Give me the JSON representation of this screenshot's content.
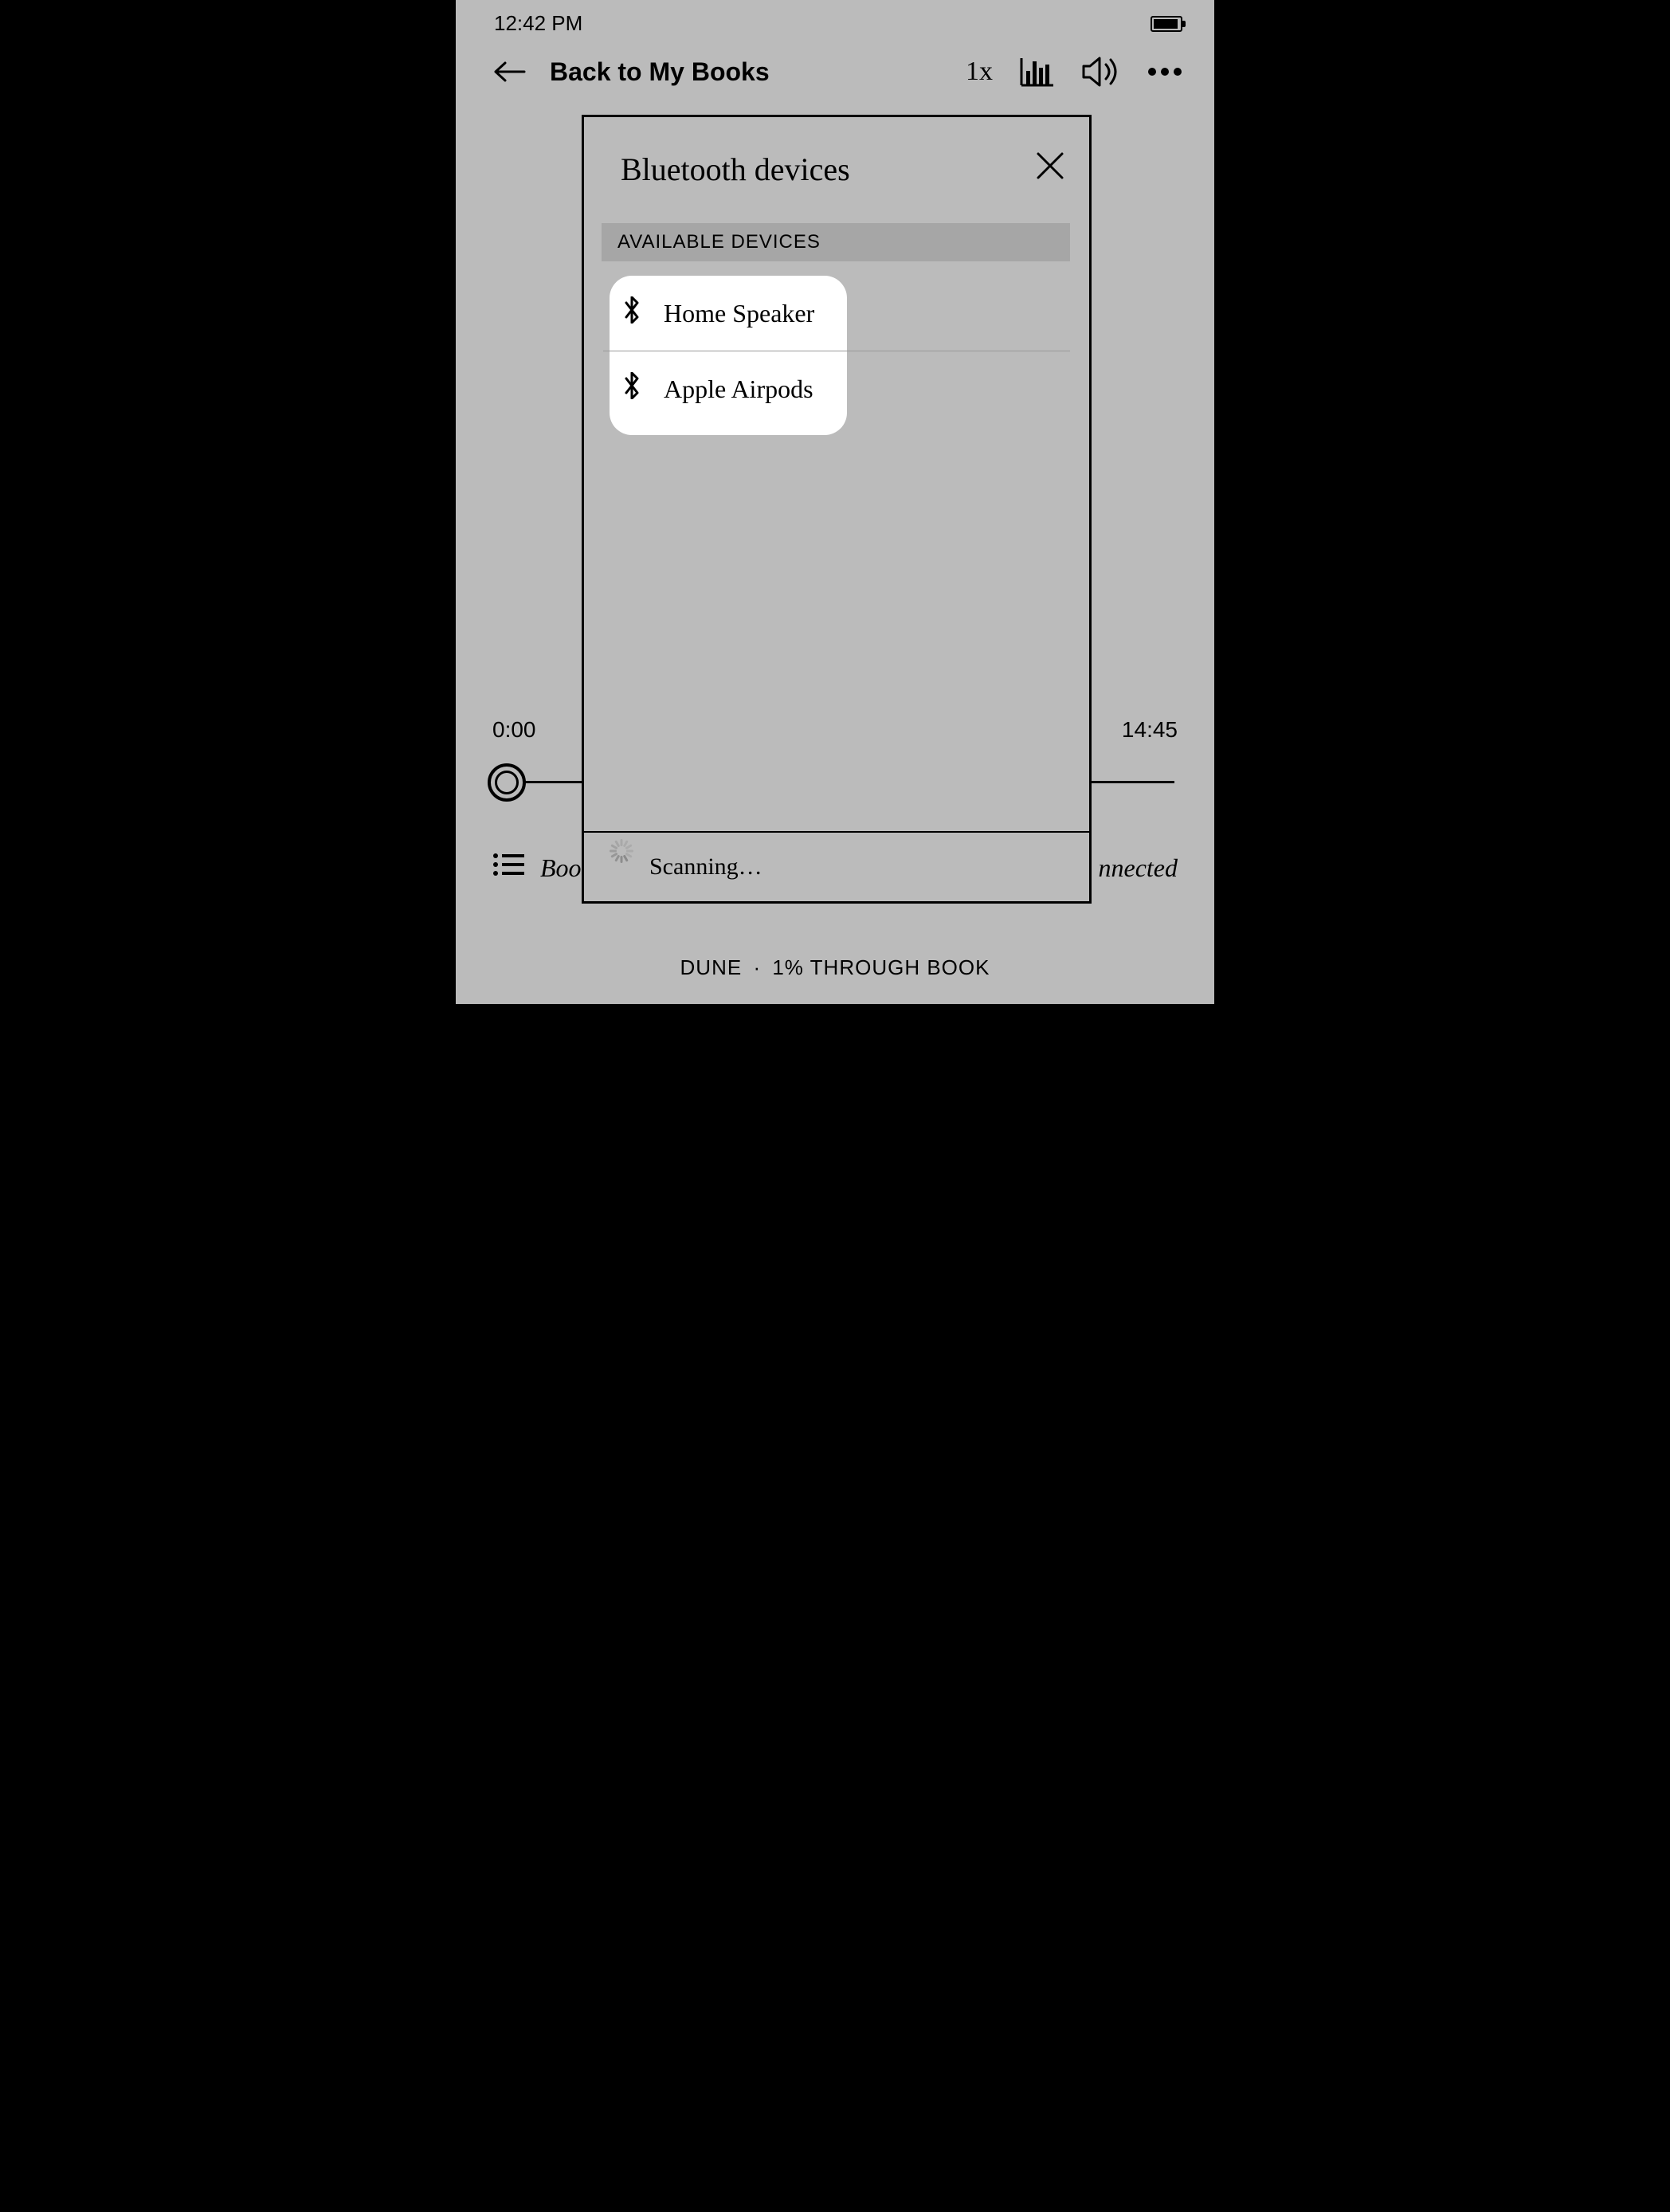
{
  "status": {
    "time": "12:42 PM"
  },
  "header": {
    "back_label": "Back to My Books",
    "speed": "1x"
  },
  "playback": {
    "elapsed": "0:00",
    "remaining": "14:45"
  },
  "bottom": {
    "left_partial": "Boo",
    "right_partial": "nnected"
  },
  "footer": {
    "book": "DUNE",
    "separator": "·",
    "progress": "1% THROUGH BOOK"
  },
  "dialog": {
    "title": "Bluetooth devices",
    "section_header": "AVAILABLE DEVICES",
    "devices": [
      {
        "name": "Home Speaker"
      },
      {
        "name": "Apple Airpods"
      }
    ],
    "scanning": "Scanning…"
  }
}
